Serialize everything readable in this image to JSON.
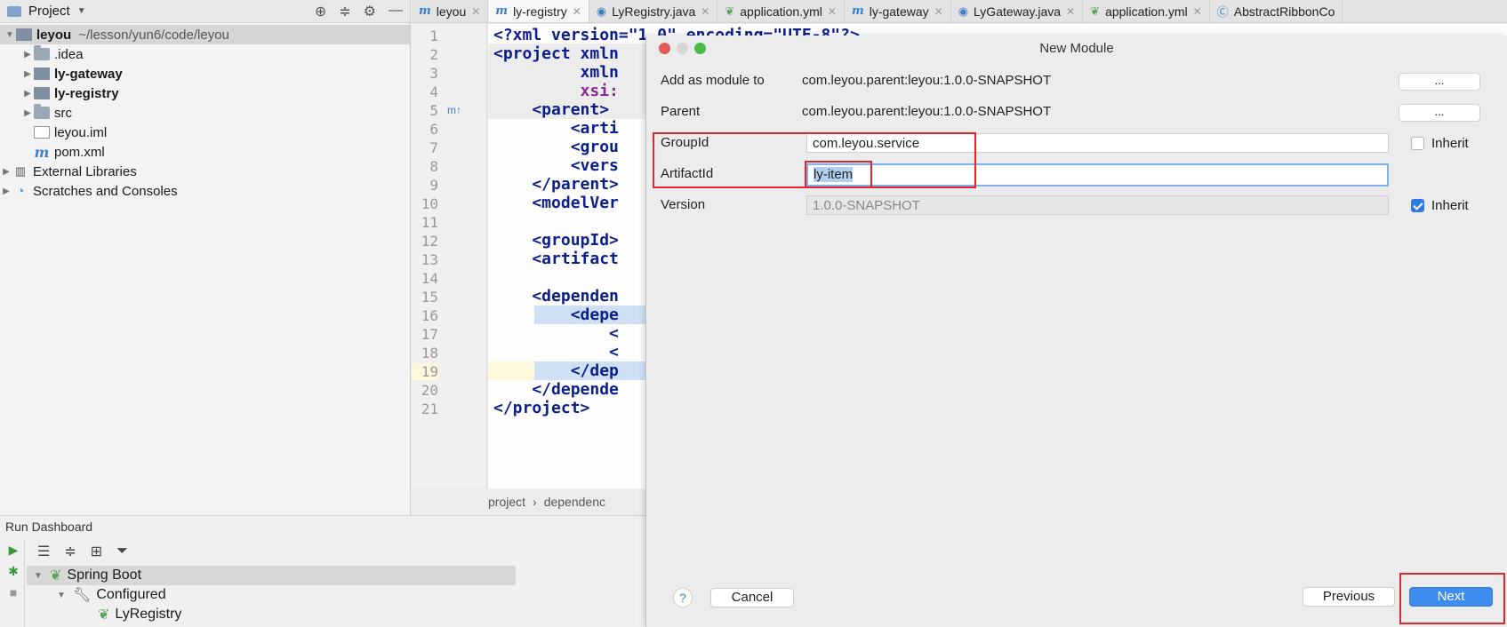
{
  "project_panel": {
    "title": "Project",
    "root": {
      "name": "leyou",
      "path": "~/lesson/yun6/code/leyou"
    },
    "items": [
      {
        "label": ".idea"
      },
      {
        "label": "ly-gateway"
      },
      {
        "label": "ly-registry"
      },
      {
        "label": "src"
      },
      {
        "label": "leyou.iml"
      },
      {
        "label": "pom.xml"
      }
    ],
    "external": "External Libraries",
    "scratches": "Scratches and Consoles"
  },
  "tabs": [
    {
      "label": "leyou",
      "icon": "maven-icon"
    },
    {
      "label": "ly-registry",
      "icon": "maven-icon"
    },
    {
      "label": "LyRegistry.java",
      "icon": "spring-class-icon"
    },
    {
      "label": "application.yml",
      "icon": "spring-config-icon"
    },
    {
      "label": "ly-gateway",
      "icon": "maven-icon"
    },
    {
      "label": "LyGateway.java",
      "icon": "spring-class-icon"
    },
    {
      "label": "application.yml",
      "icon": "spring-config-icon"
    },
    {
      "label": "AbstractRibbonCo",
      "icon": "class-icon"
    }
  ],
  "editor": {
    "line_numbers": [
      "1",
      "2",
      "3",
      "4",
      "5",
      "6",
      "7",
      "8",
      "9",
      "10",
      "11",
      "12",
      "13",
      "14",
      "15",
      "16",
      "17",
      "18",
      "19",
      "20",
      "21"
    ],
    "lines": [
      "<?xml version=\"1.0\" encoding=\"UTF-8\"?>",
      "<project xmln",
      "         xmln",
      "         xsi:",
      "    <parent>",
      "        <arti",
      "        <grou",
      "        <vers",
      "    </parent>",
      "    <modelVer",
      "",
      "    <groupId>",
      "    <artifact",
      "",
      "    <dependen",
      "        <depe",
      "            <",
      "            <",
      "        </dep",
      "    </depende",
      "</project>"
    ],
    "breadcrumb": [
      "project",
      "dependenc"
    ]
  },
  "run_dashboard": {
    "title": "Run Dashboard",
    "tree": [
      {
        "label": "Spring Boot"
      },
      {
        "label": "Configured"
      },
      {
        "label": "LyRegistry"
      }
    ]
  },
  "dialog": {
    "title": "New Module",
    "add_as_module_label": "Add as module to",
    "add_as_module_value": "com.leyou.parent:leyou:1.0.0-SNAPSHOT",
    "parent_label": "Parent",
    "parent_value": "com.leyou.parent:leyou:1.0.0-SNAPSHOT",
    "dots": "...",
    "groupid_label": "GroupId",
    "groupid_value": "com.leyou.service",
    "artifactid_label": "ArtifactId",
    "artifactid_value": "ly-item",
    "version_label": "Version",
    "version_value": "1.0.0-SNAPSHOT",
    "inherit_label": "Inherit",
    "groupid_inherit": false,
    "version_inherit": true,
    "help": "?",
    "cancel": "Cancel",
    "previous": "Previous",
    "next": "Next"
  },
  "colors": {
    "highlight_box": "#e3262b",
    "accent": "#3f8cf0"
  }
}
